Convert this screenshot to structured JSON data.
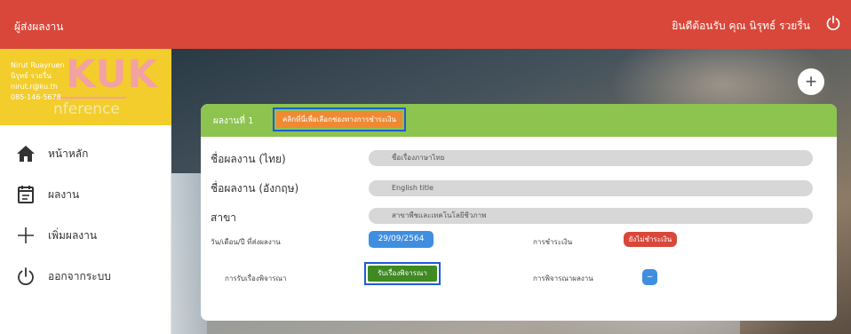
{
  "header": {
    "title": "ผู้ส่งผลงาน",
    "welcome": "ยินดีต้อนรับ คุณ นิรุทธ์ รวยรื่น"
  },
  "sidebar": {
    "logo": {
      "main": "KUK",
      "sub": "nference"
    },
    "user": {
      "name_en": "Nirut Ruayruen",
      "name_th": "นิรุทธ์ รวยรื่น",
      "email": "nirut.r@ku.th",
      "phone": "085-146-5678"
    },
    "items": [
      {
        "label": "หน้าหลัก",
        "icon": "home-icon"
      },
      {
        "label": "ผลงาน",
        "icon": "document-icon"
      },
      {
        "label": "เพิ่มผลงาน",
        "icon": "plus-icon"
      },
      {
        "label": "ออกจากระบบ",
        "icon": "power-icon"
      }
    ]
  },
  "card": {
    "title": "ผลงานที่ 1",
    "pay_link": "คลิกที่นี่เพื่อเลือกช่องทางการชำระเงิน",
    "fields": [
      {
        "label": "ชื่อผลงาน (ไทย)",
        "value": "ชื่อเรื่องภาษาไทย"
      },
      {
        "label": "ชื่อผลงาน (อังกฤษ)",
        "value": "English title"
      },
      {
        "label": "สาขา",
        "value": "สาขาพืชและเทคโนโลยีชีวภาพ"
      }
    ],
    "submit_date_label": "วัน/เดือน/ปี ที่ส่งผลงาน",
    "submit_date": "29/09/2564",
    "payment_label": "การชำระเงิน",
    "payment_status": "ยังไม่ชำระเงิน",
    "acceptance_label": "การรับเรื่องพิจารณา",
    "acceptance_status": "รับเรื่องพิจารณา",
    "review_label": "การพิจารณาผลงาน"
  },
  "colors": {
    "topbar": "#d9473a",
    "sidebar_header": "#f2cd2c",
    "card_header": "#8dc34f",
    "pay_link": "#ef8a33",
    "date_pill": "#3f8ee0",
    "unpaid": "#d9473a",
    "accepted": "#3f8a22",
    "highlight_border": "#1f5bd6"
  }
}
